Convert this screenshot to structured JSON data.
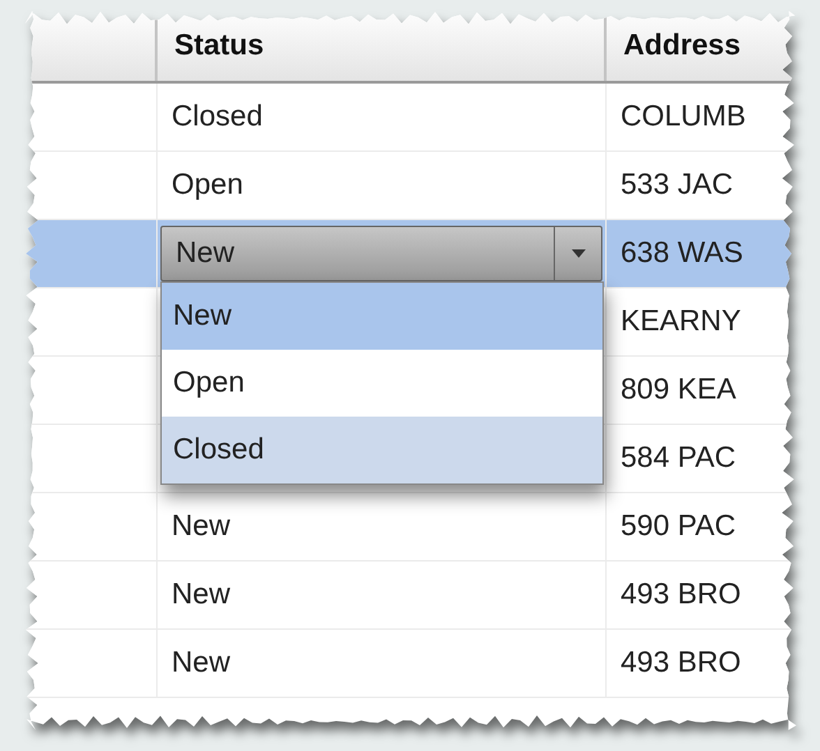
{
  "table": {
    "columns": [
      "Status",
      "Address"
    ],
    "rows": [
      {
        "status": "Closed",
        "address": "COLUMB",
        "selected": false
      },
      {
        "status": "Open",
        "address": "533 JAC",
        "selected": false
      },
      {
        "status": "New",
        "address": "638 WAS",
        "selected": true,
        "editing": true
      },
      {
        "address": "KEARNY",
        "selected": false
      },
      {
        "address": "809 KEA",
        "selected": false
      },
      {
        "address": "584 PAC",
        "selected": false
      },
      {
        "status": "New",
        "address": "590 PAC",
        "selected": false
      },
      {
        "status": "New",
        "address": "493 BRO",
        "selected": false
      },
      {
        "status": "New",
        "address": "493 BRO",
        "selected": false
      }
    ]
  },
  "dropdown": {
    "options": [
      {
        "label": "New",
        "selected": true,
        "hovered": false
      },
      {
        "label": "Open",
        "selected": false,
        "hovered": false
      },
      {
        "label": "Closed",
        "selected": false,
        "hovered": true
      }
    ]
  }
}
